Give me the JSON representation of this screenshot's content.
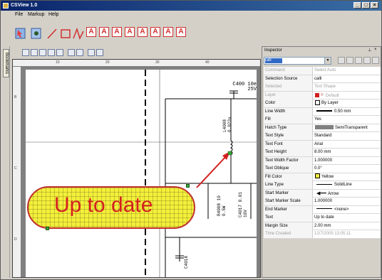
{
  "window": {
    "title": "CSView 1.0",
    "controls": [
      "_",
      "□",
      "×"
    ]
  },
  "menu": [
    "File",
    "Markup",
    "Help"
  ],
  "left_tab": "Bookmarks",
  "drawing": {
    "component_labels": [
      {
        "id": "c400",
        "text": "C400 10e 25V"
      },
      {
        "id": "l4008",
        "text": "L4008 0.022u"
      },
      {
        "id": "r4008",
        "text": "R4008 10 0.5W"
      },
      {
        "id": "c4017",
        "text": "C4017 0.01 16V"
      },
      {
        "id": "c4018",
        "text": "C4018"
      }
    ],
    "callout_text": "Up to date",
    "colors": {
      "callout_fill": "#f4ef3a",
      "callout_border": "#c03030",
      "callout_text": "#d42020",
      "arrow": "#d42020",
      "grip": "#3aaa3a"
    }
  },
  "inspector": {
    "title": "Inspector",
    "selected": "calli",
    "rows": [
      {
        "k": "Command",
        "v": "Select Auto",
        "dim": true
      },
      {
        "k": "Selection Source",
        "v": "calli"
      },
      {
        "k": "Selected",
        "v": "Text Shape",
        "dim": true
      },
      {
        "k": "Layer",
        "v": "Default",
        "dim": true
      },
      {
        "k": "Color",
        "v": "By Layer"
      },
      {
        "k": "Line Width",
        "v": "0.50 mm"
      },
      {
        "k": "Fill",
        "v": "Yes"
      },
      {
        "k": "Hatch Type",
        "v": "SemiTransparent"
      },
      {
        "k": "Text Style",
        "v": "Standard"
      },
      {
        "k": "Text Font",
        "v": "Arial"
      },
      {
        "k": "Text Height",
        "v": "8.00 mm"
      },
      {
        "k": "Text Width Factor",
        "v": "1.000000"
      },
      {
        "k": "Text Oblique",
        "v": "0.0°"
      },
      {
        "k": "Fill Color",
        "v": "Yellow"
      },
      {
        "k": "Line Type",
        "v": "SolidLine"
      },
      {
        "k": "Start Marker",
        "v": "Arrow"
      },
      {
        "k": "Start Marker Scale",
        "v": "1.000000"
      },
      {
        "k": "End Marker",
        "v": "<none>"
      },
      {
        "k": "Text",
        "v": "Up to date"
      },
      {
        "k": "Margin Size",
        "v": "2.00 mm"
      },
      {
        "k": "Time Created",
        "v": "12/7/2005 13:05:11",
        "dim": true
      }
    ]
  }
}
